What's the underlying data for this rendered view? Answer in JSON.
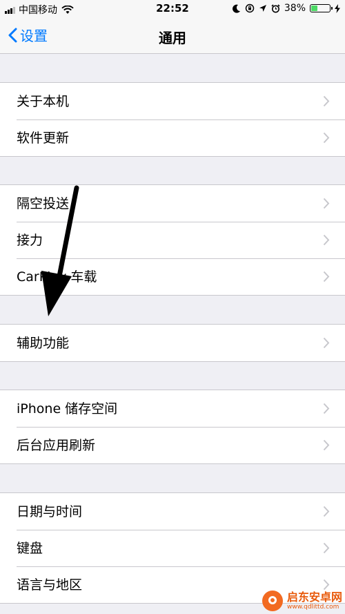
{
  "status_bar": {
    "carrier": "中国移动",
    "time": "22:52",
    "battery_percent": "38%",
    "battery_level": 0.38,
    "icons": [
      "signal-icon",
      "wifi-icon",
      "moon-icon",
      "rotation-lock-icon",
      "location-icon",
      "alarm-icon",
      "battery-icon",
      "charging-icon"
    ]
  },
  "nav": {
    "back_label": "设置",
    "title": "通用"
  },
  "groups": [
    {
      "rows": [
        "关于本机",
        "软件更新"
      ]
    },
    {
      "rows": [
        "隔空投送",
        "接力",
        "CarPlay 车载"
      ]
    },
    {
      "rows": [
        "辅助功能"
      ]
    },
    {
      "rows": [
        "iPhone 储存空间",
        "后台应用刷新"
      ]
    },
    {
      "rows": [
        "日期与时间",
        "键盘",
        "语言与地区"
      ]
    }
  ],
  "annotation": {
    "icon": "arrow-down-icon",
    "color": "#000000"
  },
  "watermark": {
    "title": "启东安卓网",
    "url": "www.qdlittd.com"
  },
  "colors": {
    "accent": "#007aff",
    "background": "#efeff4",
    "separator": "#c8c7cc",
    "chevron": "#c7c7cc",
    "battery": "#4cd964",
    "watermark": "#f26a21"
  }
}
